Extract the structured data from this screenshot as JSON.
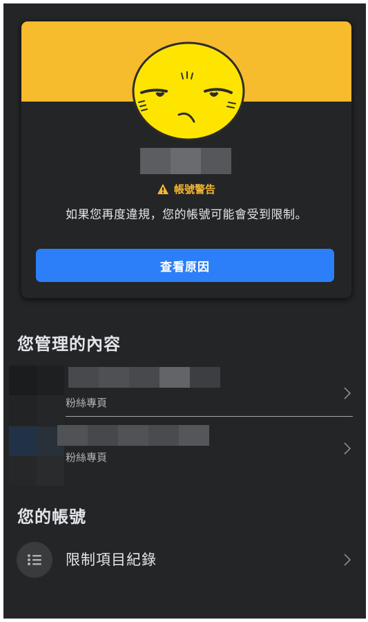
{
  "warning_card": {
    "badge_title": "帳號警告",
    "message": "如果您再度違規，您的帳號可能會受到限制。",
    "button_label": "查看原因",
    "colors": {
      "banner": "#f7bb2e",
      "button": "#2d7ff9",
      "warning_text": "#f5b731"
    }
  },
  "managed_section": {
    "title": "您管理的內容",
    "items": [
      {
        "subtitle": "粉絲專頁"
      },
      {
        "subtitle": "粉絲專頁"
      }
    ]
  },
  "account_section": {
    "title": "您的帳號",
    "items": [
      {
        "label": "限制項目紀錄",
        "icon": "list-icon"
      }
    ]
  }
}
